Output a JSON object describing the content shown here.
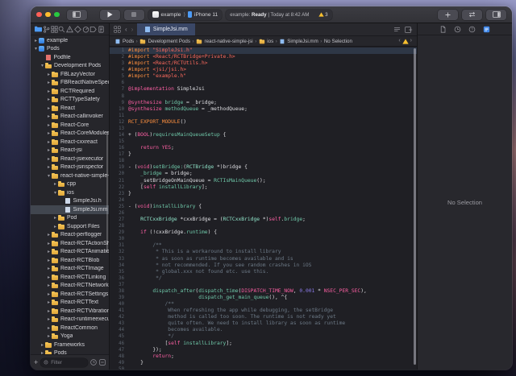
{
  "colors": {
    "accent": "#4d9bf5",
    "folder": "#f3c253",
    "warning": "#f7bf2f",
    "traffic": [
      "#ff5f57",
      "#febc2e",
      "#28c840"
    ],
    "token_preprocessor": "#fd8f3f",
    "token_string": "#fc6a5d",
    "token_keyword": "#fc5fa3",
    "token_function": "#6fc8a9",
    "token_type": "#8fe3c8",
    "token_number": "#8b7be8",
    "token_comment": "#6c7986"
  },
  "toolbar": {
    "scheme": {
      "target": "example",
      "separator": "⟩",
      "device": "iPhone 11"
    },
    "status": {
      "prefix": "example: ",
      "state": "Ready",
      "suffix": " | Today at 8:42 AM",
      "warning_count": "3"
    }
  },
  "sidebar": {
    "nav_icons": [
      {
        "name": "project-navigator-icon",
        "selected": true
      },
      {
        "name": "source-control-navigator-icon",
        "selected": false
      },
      {
        "name": "symbol-navigator-icon",
        "selected": false
      },
      {
        "name": "find-navigator-icon",
        "selected": false
      },
      {
        "name": "issue-navigator-icon",
        "selected": false
      },
      {
        "name": "test-navigator-icon",
        "selected": false
      },
      {
        "name": "debug-navigator-icon",
        "selected": false
      },
      {
        "name": "breakpoint-navigator-icon",
        "selected": false
      },
      {
        "name": "report-navigator-icon",
        "selected": false
      }
    ],
    "filter": {
      "placeholder": "Filter"
    },
    "tree": [
      {
        "l": 0,
        "a": "r",
        "i": "proj",
        "t": "example"
      },
      {
        "l": 0,
        "a": "v",
        "i": "proj",
        "t": "Pods"
      },
      {
        "l": 1,
        "a": "",
        "i": "docred",
        "t": "Podfile"
      },
      {
        "l": 1,
        "a": "v",
        "i": "folder",
        "t": "Development Pods"
      },
      {
        "l": 2,
        "a": "r",
        "i": "folder",
        "t": "FBLazyVector"
      },
      {
        "l": 2,
        "a": "r",
        "i": "folder",
        "t": "FBReactNativeSpec"
      },
      {
        "l": 2,
        "a": "r",
        "i": "folder",
        "t": "RCTRequired"
      },
      {
        "l": 2,
        "a": "r",
        "i": "folder",
        "t": "RCTTypeSafety"
      },
      {
        "l": 2,
        "a": "r",
        "i": "folder",
        "t": "React"
      },
      {
        "l": 2,
        "a": "r",
        "i": "folder",
        "t": "React-callinvoker"
      },
      {
        "l": 2,
        "a": "r",
        "i": "folder",
        "t": "React-Core"
      },
      {
        "l": 2,
        "a": "r",
        "i": "folder",
        "t": "React-CoreModules"
      },
      {
        "l": 2,
        "a": "r",
        "i": "folder",
        "t": "React-cxxreact"
      },
      {
        "l": 2,
        "a": "r",
        "i": "folder",
        "t": "React-jsi"
      },
      {
        "l": 2,
        "a": "r",
        "i": "folder",
        "t": "React-jsiexecutor"
      },
      {
        "l": 2,
        "a": "r",
        "i": "folder",
        "t": "React-jsinspector"
      },
      {
        "l": 2,
        "a": "v",
        "i": "folder",
        "t": "react-native-simple-jsi"
      },
      {
        "l": 3,
        "a": "r",
        "i": "folder",
        "t": "cpp"
      },
      {
        "l": 3,
        "a": "v",
        "i": "folder",
        "t": "ios"
      },
      {
        "l": 4,
        "a": "",
        "i": "doc",
        "t": "SimpleJsi.h"
      },
      {
        "l": 4,
        "a": "",
        "i": "doc",
        "t": "SimpleJsi.mm",
        "sel": true
      },
      {
        "l": 3,
        "a": "r",
        "i": "folder",
        "t": "Pod"
      },
      {
        "l": 3,
        "a": "r",
        "i": "folder",
        "t": "Support Files"
      },
      {
        "l": 2,
        "a": "r",
        "i": "folder",
        "t": "React-perflogger"
      },
      {
        "l": 2,
        "a": "r",
        "i": "folder",
        "t": "React-RCTActionSheet"
      },
      {
        "l": 2,
        "a": "r",
        "i": "folder",
        "t": "React-RCTAnimation"
      },
      {
        "l": 2,
        "a": "r",
        "i": "folder",
        "t": "React-RCTBlob"
      },
      {
        "l": 2,
        "a": "r",
        "i": "folder",
        "t": "React-RCTImage"
      },
      {
        "l": 2,
        "a": "r",
        "i": "folder",
        "t": "React-RCTLinking"
      },
      {
        "l": 2,
        "a": "r",
        "i": "folder",
        "t": "React-RCTNetwork"
      },
      {
        "l": 2,
        "a": "r",
        "i": "folder",
        "t": "React-RCTSettings"
      },
      {
        "l": 2,
        "a": "r",
        "i": "folder",
        "t": "React-RCTText"
      },
      {
        "l": 2,
        "a": "r",
        "i": "folder",
        "t": "React-RCTVibration"
      },
      {
        "l": 2,
        "a": "r",
        "i": "folder",
        "t": "React-runtimeexecutor"
      },
      {
        "l": 2,
        "a": "r",
        "i": "folder",
        "t": "ReactCommon"
      },
      {
        "l": 2,
        "a": "r",
        "i": "folder",
        "t": "Yoga"
      },
      {
        "l": 1,
        "a": "r",
        "i": "folder",
        "t": "Frameworks"
      },
      {
        "l": 1,
        "a": "r",
        "i": "folder",
        "t": "Pods"
      }
    ]
  },
  "editor": {
    "tab": {
      "label": "SimpleJsi.mm"
    },
    "breadcrumb": [
      {
        "icon": "docblue",
        "label": "Pods"
      },
      {
        "icon": "folder",
        "label": "Development Pods"
      },
      {
        "icon": "folder",
        "label": "react-native-simple-jsi"
      },
      {
        "icon": "folder",
        "label": "ios"
      },
      {
        "icon": "docblue",
        "label": "SimpleJsi.mm"
      },
      {
        "icon": "",
        "label": "No Selection"
      }
    ],
    "lines": [
      {
        "n": 1,
        "h": true,
        "s": [
          [
            "pp",
            "#import"
          ],
          [
            "pl",
            " "
          ],
          [
            "str",
            "\"SimpleJsi.h\""
          ]
        ]
      },
      {
        "n": 2,
        "s": [
          [
            "pp",
            "#import"
          ],
          [
            "pl",
            " "
          ],
          [
            "str",
            "<React/RCTBridge+Private.h>"
          ]
        ]
      },
      {
        "n": 3,
        "s": [
          [
            "pp",
            "#import"
          ],
          [
            "pl",
            " "
          ],
          [
            "str",
            "<React/RCTUtils.h>"
          ]
        ]
      },
      {
        "n": 4,
        "s": [
          [
            "pp",
            "#import"
          ],
          [
            "pl",
            " "
          ],
          [
            "str",
            "<jsi/jsi.h>"
          ]
        ]
      },
      {
        "n": 5,
        "s": [
          [
            "pp",
            "#import"
          ],
          [
            "pl",
            " "
          ],
          [
            "str",
            "\"example.h\""
          ]
        ]
      },
      {
        "n": 6,
        "s": []
      },
      {
        "n": 7,
        "s": [
          [
            "kw",
            "@implementation"
          ],
          [
            "pl",
            " SimpleJsi"
          ]
        ]
      },
      {
        "n": 8,
        "s": []
      },
      {
        "n": 9,
        "s": [
          [
            "kw",
            "@synthesize"
          ],
          [
            "pl",
            " "
          ],
          [
            "fn",
            "bridge"
          ],
          [
            "pl",
            " = _bridge;"
          ]
        ]
      },
      {
        "n": 10,
        "s": [
          [
            "kw",
            "@synthesize"
          ],
          [
            "pl",
            " "
          ],
          [
            "fn",
            "methodQueue"
          ],
          [
            "pl",
            " = _methodQueue;"
          ]
        ]
      },
      {
        "n": 11,
        "s": []
      },
      {
        "n": 12,
        "s": [
          [
            "pp",
            "RCT_EXPORT_MODULE"
          ],
          [
            "pl",
            "()"
          ]
        ]
      },
      {
        "n": 13,
        "s": []
      },
      {
        "n": 14,
        "s": [
          [
            "pl",
            "+ ("
          ],
          [
            "kw",
            "BOOL"
          ],
          [
            "pl",
            ")"
          ],
          [
            "fn",
            "requiresMainQueueSetup"
          ],
          [
            "pl",
            " {"
          ]
        ]
      },
      {
        "n": 15,
        "s": []
      },
      {
        "n": 16,
        "s": [
          [
            "pl",
            "    "
          ],
          [
            "kw",
            "return"
          ],
          [
            "pl",
            " "
          ],
          [
            "kw",
            "YES"
          ],
          [
            "pl",
            ";"
          ]
        ]
      },
      {
        "n": 17,
        "s": [
          [
            "pl",
            "}"
          ]
        ]
      },
      {
        "n": 18,
        "s": []
      },
      {
        "n": 19,
        "s": [
          [
            "pl",
            "- ("
          ],
          [
            "kw",
            "void"
          ],
          [
            "pl",
            ")"
          ],
          [
            "fn",
            "setBridge:"
          ],
          [
            "pl",
            "("
          ],
          [
            "ty",
            "RCTBridge"
          ],
          [
            "pl",
            " *)bridge {"
          ]
        ]
      },
      {
        "n": 20,
        "s": [
          [
            "pl",
            "    "
          ],
          [
            "fn",
            "_bridge"
          ],
          [
            "pl",
            " = bridge;"
          ]
        ]
      },
      {
        "n": 21,
        "s": [
          [
            "pl",
            "    _setBridgeOnMainQueue = "
          ],
          [
            "fn",
            "RCTIsMainQueue"
          ],
          [
            "pl",
            "();"
          ]
        ]
      },
      {
        "n": 22,
        "s": [
          [
            "pl",
            "    ["
          ],
          [
            "kw",
            "self"
          ],
          [
            "pl",
            " "
          ],
          [
            "fn",
            "installLibrary"
          ],
          [
            "pl",
            "];"
          ]
        ]
      },
      {
        "n": 23,
        "s": [
          [
            "pl",
            "}"
          ]
        ]
      },
      {
        "n": 24,
        "s": []
      },
      {
        "n": 25,
        "s": [
          [
            "pl",
            "- ("
          ],
          [
            "kw",
            "void"
          ],
          [
            "pl",
            ")"
          ],
          [
            "fn",
            "installLibrary"
          ],
          [
            "pl",
            " {"
          ]
        ]
      },
      {
        "n": 26,
        "s": []
      },
      {
        "n": 27,
        "s": [
          [
            "pl",
            "    "
          ],
          [
            "ty",
            "RCTCxxBridge"
          ],
          [
            "pl",
            " *cxxBridge = ("
          ],
          [
            "ty",
            "RCTCxxBridge"
          ],
          [
            "pl",
            " *)"
          ],
          [
            "kw",
            "self"
          ],
          [
            "pl",
            "."
          ],
          [
            "fn",
            "bridge"
          ],
          [
            "pl",
            ";"
          ]
        ]
      },
      {
        "n": 28,
        "s": []
      },
      {
        "n": 29,
        "s": [
          [
            "pl",
            "    "
          ],
          [
            "kw",
            "if"
          ],
          [
            "pl",
            " (!cxxBridge."
          ],
          [
            "fn",
            "runtime"
          ],
          [
            "pl",
            ") {"
          ]
        ]
      },
      {
        "n": 30,
        "s": []
      },
      {
        "n": 31,
        "s": [
          [
            "cm",
            "        /**"
          ]
        ]
      },
      {
        "n": 32,
        "s": [
          [
            "cm",
            "         * This is a workaround to install library"
          ]
        ]
      },
      {
        "n": 33,
        "s": [
          [
            "cm",
            "         * as soon as runtime becomes available and is"
          ]
        ]
      },
      {
        "n": 34,
        "s": [
          [
            "cm",
            "         * not recommended. If you see random crashes in iOS"
          ]
        ]
      },
      {
        "n": 35,
        "s": [
          [
            "cm",
            "         * global.xxx not found etc. use this."
          ]
        ]
      },
      {
        "n": 36,
        "s": [
          [
            "cm",
            "         */"
          ]
        ]
      },
      {
        "n": 37,
        "s": []
      },
      {
        "n": 38,
        "s": [
          [
            "pl",
            "        "
          ],
          [
            "fn",
            "dispatch_after"
          ],
          [
            "pl",
            "("
          ],
          [
            "fn",
            "dispatch_time"
          ],
          [
            "pl",
            "("
          ],
          [
            "kw",
            "DISPATCH_TIME_NOW"
          ],
          [
            "pl",
            ", "
          ],
          [
            "num",
            "0.001"
          ],
          [
            "pl",
            " * "
          ],
          [
            "kw",
            "NSEC_PER_SEC"
          ],
          [
            "pl",
            "),"
          ]
        ]
      },
      {
        "n": 39,
        "s": [
          [
            "pl",
            "                       "
          ],
          [
            "fn",
            "dispatch_get_main_queue"
          ],
          [
            "pl",
            "(), ^{"
          ]
        ]
      },
      {
        "n": 40,
        "s": [
          [
            "cm",
            "            /**"
          ]
        ]
      },
      {
        "n": 41,
        "s": [
          [
            "cm",
            "             When refreshing the app while debugging, the setBridge"
          ]
        ]
      },
      {
        "n": 42,
        "s": [
          [
            "cm",
            "             method is called too soon. The runtime is not ready yet"
          ]
        ]
      },
      {
        "n": 43,
        "s": [
          [
            "cm",
            "             quite often. We need to install library as soon as runtime"
          ]
        ]
      },
      {
        "n": 44,
        "s": [
          [
            "cm",
            "             becomes available."
          ]
        ]
      },
      {
        "n": 45,
        "s": [
          [
            "cm",
            "             */"
          ]
        ]
      },
      {
        "n": 46,
        "s": [
          [
            "pl",
            "            ["
          ],
          [
            "kw",
            "self"
          ],
          [
            "pl",
            " "
          ],
          [
            "fn",
            "installLibrary"
          ],
          [
            "pl",
            "];"
          ]
        ]
      },
      {
        "n": 47,
        "s": [
          [
            "pl",
            "        });"
          ]
        ]
      },
      {
        "n": 48,
        "s": [
          [
            "pl",
            "        "
          ],
          [
            "kw",
            "return"
          ],
          [
            "pl",
            ";"
          ]
        ]
      },
      {
        "n": 49,
        "s": [
          [
            "pl",
            "    }"
          ]
        ]
      },
      {
        "n": 50,
        "s": []
      }
    ]
  },
  "inspector": {
    "icons": [
      {
        "name": "file-inspector-icon",
        "selected": false
      },
      {
        "name": "history-inspector-icon",
        "selected": false
      },
      {
        "name": "quick-help-inspector-icon",
        "selected": false
      },
      {
        "name": "accessibility-inspector-icon",
        "selected": true
      }
    ],
    "empty_text": "No Selection"
  }
}
